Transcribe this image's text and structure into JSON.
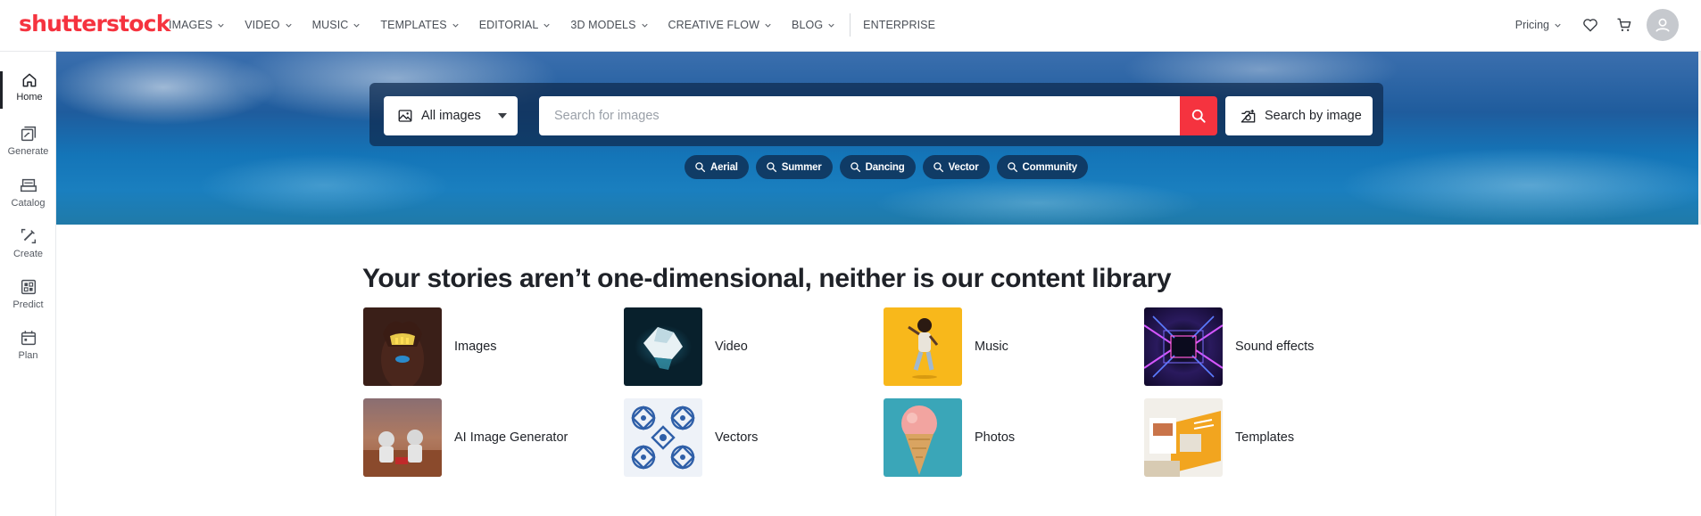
{
  "brand": {
    "logo_text": "shutterstock",
    "color": "#f5333f"
  },
  "nav": {
    "items": [
      {
        "label": "IMAGES",
        "has_dropdown": true
      },
      {
        "label": "VIDEO",
        "has_dropdown": true
      },
      {
        "label": "MUSIC",
        "has_dropdown": true
      },
      {
        "label": "TEMPLATES",
        "has_dropdown": true
      },
      {
        "label": "EDITORIAL",
        "has_dropdown": true
      },
      {
        "label": "3D MODELS",
        "has_dropdown": true
      },
      {
        "label": "CREATIVE FLOW",
        "has_dropdown": true
      },
      {
        "label": "BLOG",
        "has_dropdown": true
      }
    ],
    "enterprise": "ENTERPRISE",
    "pricing": "Pricing"
  },
  "rail": {
    "items": [
      {
        "label": "Home",
        "icon": "home-icon",
        "active": true
      },
      {
        "label": "Generate",
        "icon": "generate-icon"
      },
      {
        "label": "Catalog",
        "icon": "catalog-icon"
      },
      {
        "label": "Create",
        "icon": "create-icon"
      },
      {
        "label": "Predict",
        "icon": "predict-icon"
      },
      {
        "label": "Plan",
        "icon": "plan-icon"
      }
    ]
  },
  "search": {
    "type_value": "All images",
    "placeholder": "Search for images",
    "value": "",
    "search_by_image": "Search by image"
  },
  "chips": [
    "Aerial",
    "Summer",
    "Dancing",
    "Vector",
    "Community"
  ],
  "section": {
    "title": "Your stories aren’t one-dimensional, neither is our content library",
    "tiles": [
      {
        "label": "Images"
      },
      {
        "label": "Video"
      },
      {
        "label": "Music"
      },
      {
        "label": "Sound effects"
      },
      {
        "label": "AI Image Generator"
      },
      {
        "label": "Vectors"
      },
      {
        "label": "Photos"
      },
      {
        "label": "Templates"
      }
    ]
  }
}
